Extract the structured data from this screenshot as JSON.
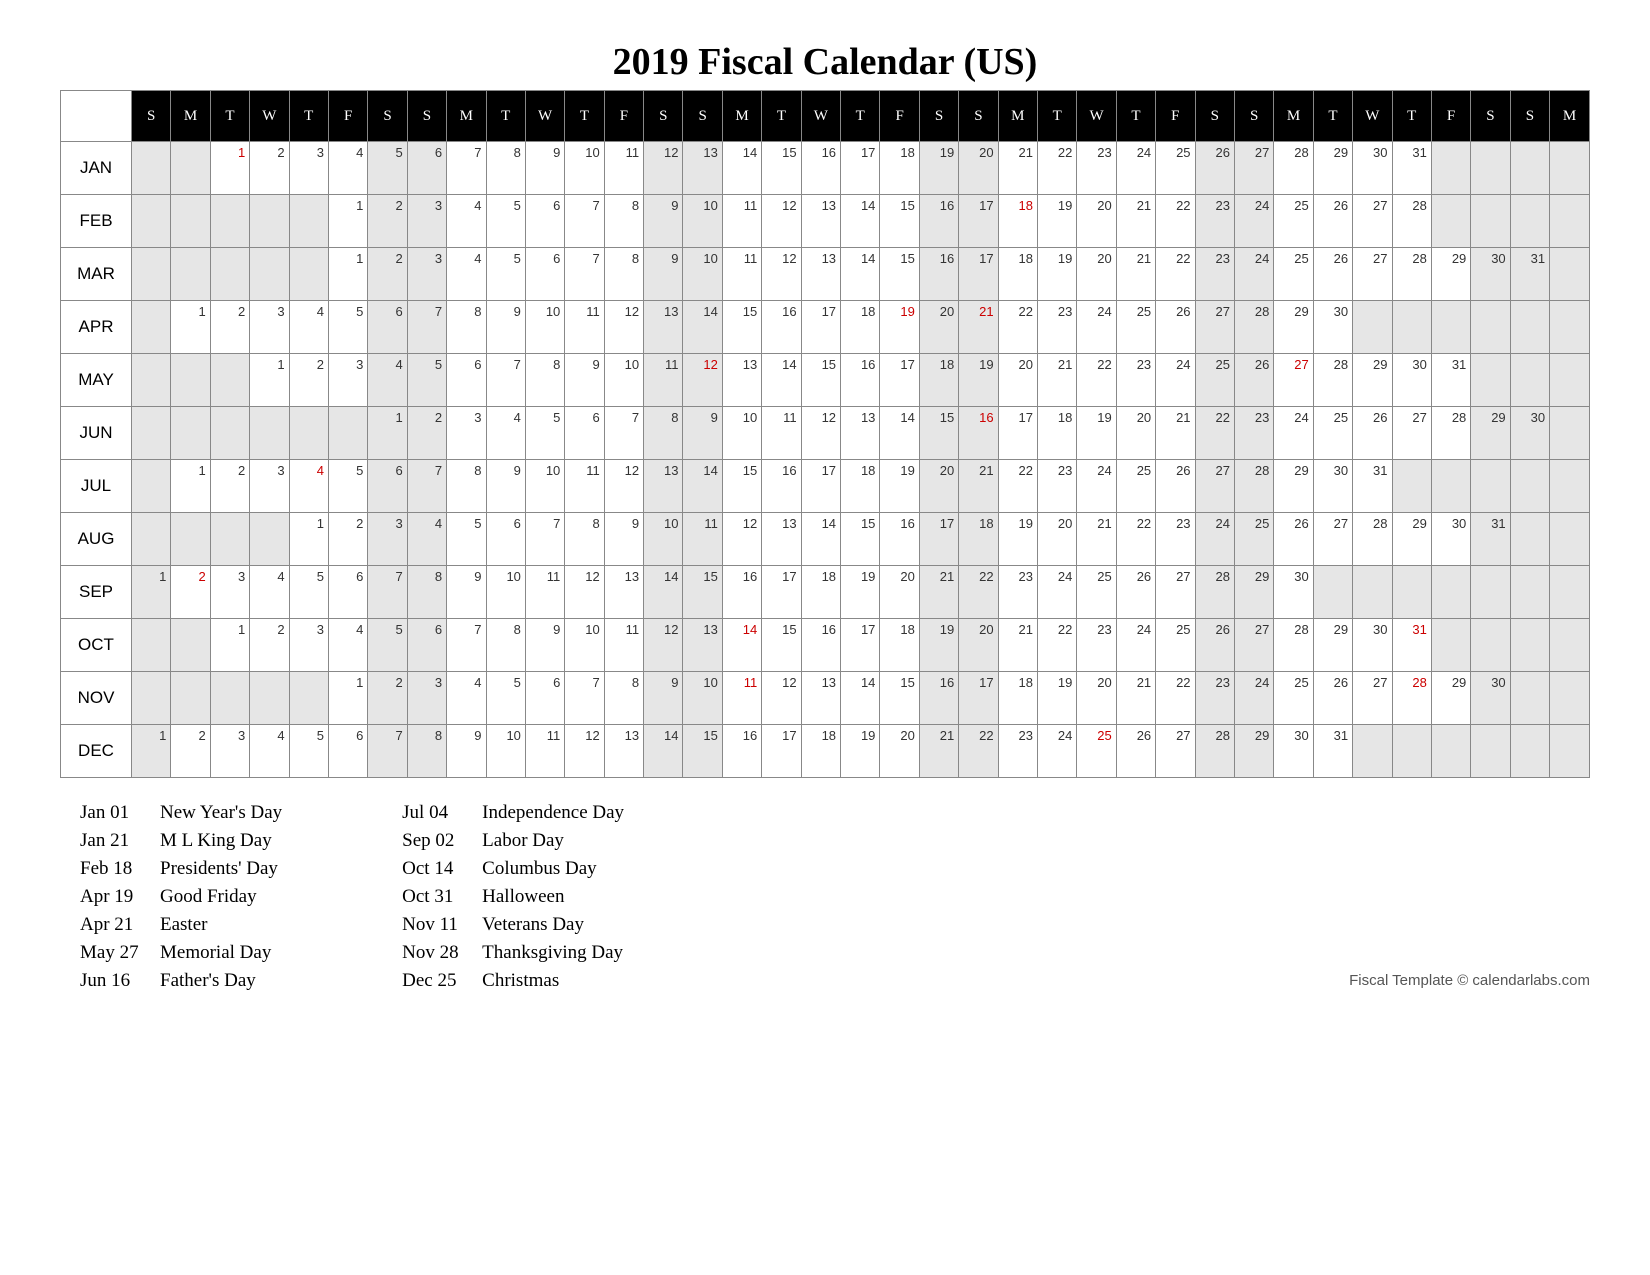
{
  "title": "2019 Fiscal Calendar (US)",
  "dow_row": [
    "S",
    "M",
    "T",
    "W",
    "T",
    "F",
    "S",
    "S",
    "M",
    "T",
    "W",
    "T",
    "F",
    "S",
    "S",
    "M",
    "T",
    "W",
    "T",
    "F",
    "S",
    "S",
    "M",
    "T",
    "W",
    "T",
    "F",
    "S",
    "S",
    "M",
    "T",
    "W",
    "T",
    "F",
    "S",
    "S",
    "M"
  ],
  "weekend_cols": [
    0,
    6,
    7,
    13,
    14,
    20,
    21,
    27,
    28,
    34,
    35,
    36
  ],
  "months": [
    {
      "abbr": "JAN",
      "offset": 2,
      "days": 31,
      "red": [
        1
      ]
    },
    {
      "abbr": "FEB",
      "offset": 5,
      "days": 28,
      "red": [
        18
      ]
    },
    {
      "abbr": "MAR",
      "offset": 5,
      "days": 31,
      "red": []
    },
    {
      "abbr": "APR",
      "offset": 1,
      "days": 30,
      "red": [
        19,
        21
      ]
    },
    {
      "abbr": "MAY",
      "offset": 3,
      "days": 31,
      "red": [
        12,
        27
      ]
    },
    {
      "abbr": "JUN",
      "offset": 6,
      "days": 30,
      "red": [
        16
      ]
    },
    {
      "abbr": "JUL",
      "offset": 1,
      "days": 31,
      "red": [
        4
      ]
    },
    {
      "abbr": "AUG",
      "offset": 4,
      "days": 31,
      "red": []
    },
    {
      "abbr": "SEP",
      "offset": 0,
      "days": 30,
      "red": [
        2
      ]
    },
    {
      "abbr": "OCT",
      "offset": 2,
      "days": 31,
      "red": [
        14,
        31
      ]
    },
    {
      "abbr": "NOV",
      "offset": 5,
      "days": 30,
      "red": [
        11,
        28
      ]
    },
    {
      "abbr": "DEC",
      "offset": 0,
      "days": 31,
      "red": [
        25
      ]
    }
  ],
  "holidays_left": [
    {
      "d": "Jan 01",
      "n": "New Year's Day"
    },
    {
      "d": "Jan 21",
      "n": "M L King Day"
    },
    {
      "d": "Feb 18",
      "n": "Presidents' Day"
    },
    {
      "d": "Apr 19",
      "n": "Good Friday"
    },
    {
      "d": "Apr 21",
      "n": "Easter"
    },
    {
      "d": "May 27",
      "n": "Memorial Day"
    },
    {
      "d": "Jun 16",
      "n": "Father's Day"
    }
  ],
  "holidays_right": [
    {
      "d": "Jul 04",
      "n": "Independence Day"
    },
    {
      "d": "Sep 02",
      "n": "Labor Day"
    },
    {
      "d": "Oct 14",
      "n": "Columbus Day"
    },
    {
      "d": "Oct 31",
      "n": "Halloween"
    },
    {
      "d": "Nov 11",
      "n": "Veterans Day"
    },
    {
      "d": "Nov 28",
      "n": "Thanksgiving Day"
    },
    {
      "d": "Dec 25",
      "n": "Christmas"
    }
  ],
  "footer": "Fiscal Template © calendarlabs.com"
}
